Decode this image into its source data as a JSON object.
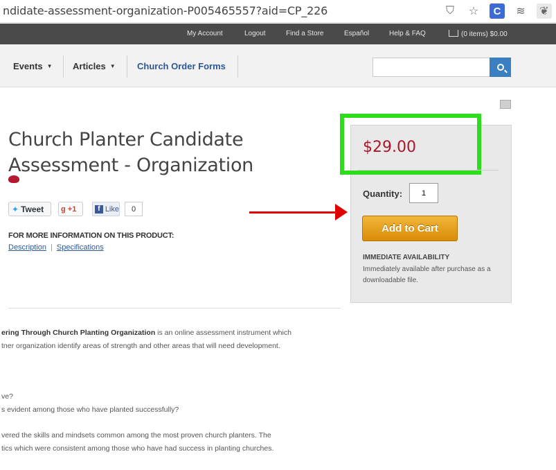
{
  "browser": {
    "url": "ndidate-assessment-organization-P005465557?aid=CP_226",
    "icons": [
      "shield-icon",
      "star-icon",
      "c-extension-icon",
      "buffer-icon",
      "evernote-icon"
    ]
  },
  "topnav": {
    "my_account": "My Account",
    "logout": "Logout",
    "find_store": "Find a Store",
    "espanol": "Español",
    "help": "Help & FAQ",
    "cart": "(0 items) $0.00"
  },
  "mainnav": {
    "events": "Events",
    "articles": "Articles",
    "church_order_forms": "Church Order Forms",
    "search_value": ""
  },
  "product": {
    "title": "Church Planter Candidate Assessment - Organization",
    "social": {
      "tweet": "Tweet",
      "gplus": "+1",
      "like": "Like",
      "like_count": "0"
    },
    "more_info": "FOR MORE INFORMATION ON THIS PRODUCT:",
    "link_description": "Description",
    "link_specifications": "Specifications"
  },
  "pricebox": {
    "price": "$29.00",
    "quantity_label": "Quantity:",
    "quantity_value": "1",
    "add_to_cart": "Add to Cart",
    "availability_heading": "IMMEDIATE AVAILABILITY",
    "availability_text": "Immediately available after purchase as a downloadable file."
  },
  "body": {
    "line1_bold": "ering Through Church Planting Organization",
    "line1_rest": " is an online assessment instrument which",
    "line2": "tner organization identify areas of strength and other areas that will need development.",
    "line3": "ve?",
    "line4": "s evident among those who have planted successfully?",
    "line5": "vered the skills and mindsets common among the most proven church planters. The",
    "line6": "tics which were consistent among those who have had success in planting churches."
  },
  "colors": {
    "price_red": "#a8182c",
    "highlight_green": "#2fdc1c",
    "arrow_red": "#e10000",
    "cart_orange": "#e9a21f",
    "link_blue": "#2b5797"
  }
}
